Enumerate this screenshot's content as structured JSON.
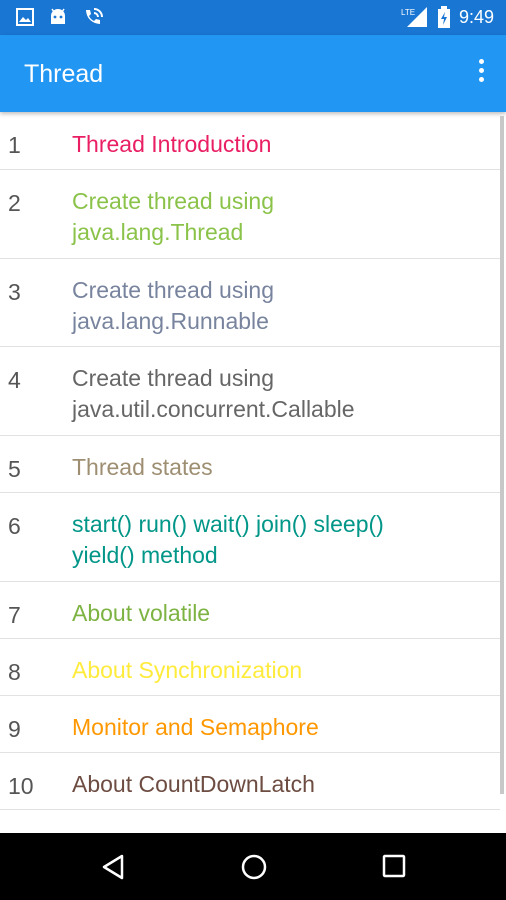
{
  "status_bar": {
    "time": "9:49",
    "network": "LTE"
  },
  "app_bar": {
    "title": "Thread"
  },
  "items": [
    {
      "num": "1",
      "label": "Thread Introduction",
      "color": "#E91E63"
    },
    {
      "num": "2",
      "label": "Create thread using\njava.lang.Thread",
      "color": "#8BC34A"
    },
    {
      "num": "3",
      "label": "Create thread using\njava.lang.Runnable",
      "color": "#78849E"
    },
    {
      "num": "4",
      "label": "Create thread using\njava.util.concurrent.Callable",
      "color": "#666666"
    },
    {
      "num": "5",
      "label": "Thread states",
      "color": "#9E8E72"
    },
    {
      "num": "6",
      "label": "start() run() wait() join() sleep()\nyield() method",
      "color": "#009688"
    },
    {
      "num": "7",
      "label": "About volatile",
      "color": "#7CB342"
    },
    {
      "num": "8",
      "label": "About Synchronization",
      "color": "#FFEB3B"
    },
    {
      "num": "9",
      "label": "Monitor and Semaphore",
      "color": "#FF9800"
    },
    {
      "num": "10",
      "label": "About CountDownLatch",
      "color": "#6D4C41"
    }
  ]
}
